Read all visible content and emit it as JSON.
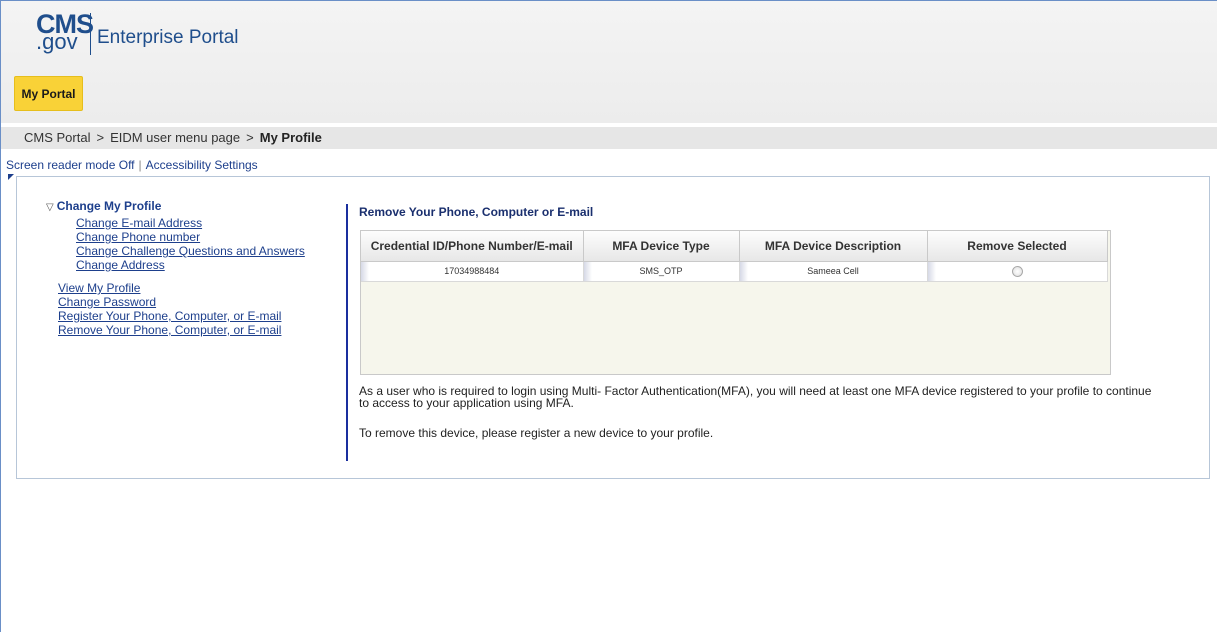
{
  "header": {
    "logo_cms": "CMS",
    "logo_gov": ".gov",
    "portal_name": "Enterprise Portal",
    "tab_label": "My Portal"
  },
  "breadcrumb": {
    "items": [
      "CMS Portal",
      "EIDM user menu page"
    ],
    "separator": ">",
    "current": "My Profile"
  },
  "accessibility": {
    "screen_reader": "Screen reader mode Off",
    "divider": "|",
    "settings": "Accessibility Settings"
  },
  "sidebar": {
    "section_title": "Change My Profile",
    "sub_items": [
      "Change E-mail Address",
      "Change Phone number",
      "Change Challenge Questions and Answers",
      "Change Address"
    ],
    "items": [
      "View My Profile",
      "Change Password",
      "Register Your Phone, Computer, or E-mail",
      "Remove Your Phone, Computer, or E-mail"
    ]
  },
  "main": {
    "title": "Remove Your Phone, Computer or E-mail",
    "table": {
      "columns": [
        "Credential ID/Phone Number/E-mail",
        "MFA Device Type",
        "MFA Device Description",
        "Remove Selected"
      ],
      "rows": [
        {
          "credential": "17034988484",
          "type": "SMS_OTP",
          "description": "Sameea Cell"
        }
      ]
    },
    "info_text": "As a user who is required to login using Multi- Factor Authentication(MFA), you will need at least one MFA device registered to your profile to continue to access to your application using MFA.",
    "remove_note": "To remove this device, please register a new device to your profile."
  },
  "colors": {
    "brand_blue": "#1f4e8c",
    "tab_yellow": "#f9d237",
    "link_blue": "#1d3f8c"
  }
}
